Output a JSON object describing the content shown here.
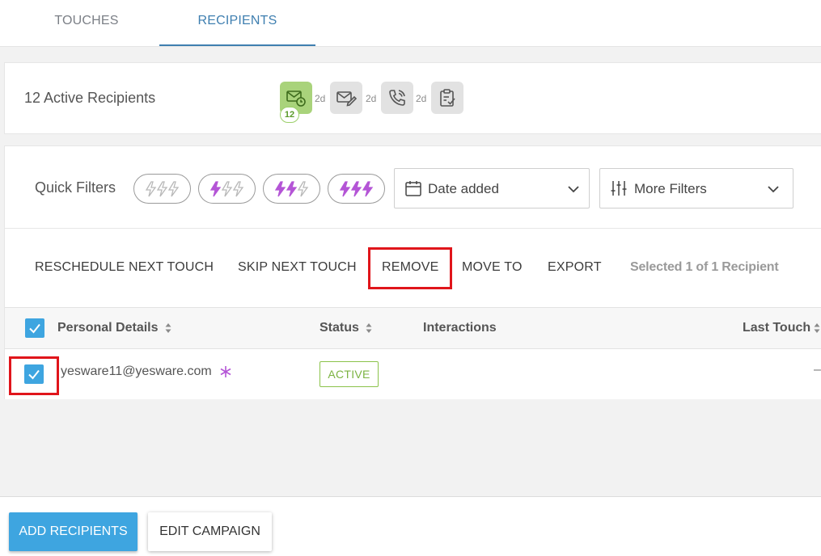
{
  "tabs": [
    {
      "label": "TOUCHES",
      "active": false
    },
    {
      "label": "RECIPIENTS",
      "active": true
    }
  ],
  "summary": {
    "title": "12 Active Recipients",
    "touches": [
      {
        "icon": "email-scheduled-icon",
        "active": true,
        "count": "12"
      },
      {
        "icon": "email-edit-icon",
        "active": false
      },
      {
        "icon": "phone-call-icon",
        "active": false
      },
      {
        "icon": "task-clipboard-icon",
        "active": false
      }
    ],
    "gaps": [
      "2d",
      "2d",
      "2d"
    ]
  },
  "quick_filters": {
    "label": "Quick Filters",
    "pills": [
      {
        "icon": "bolt-level-0-icon",
        "level": 0
      },
      {
        "icon": "bolt-level-1-icon",
        "level": 1
      },
      {
        "icon": "bolt-level-2-icon",
        "level": 2
      },
      {
        "icon": "bolt-level-3-icon",
        "level": 3
      }
    ],
    "date_select": "Date added",
    "more_filters": "More Filters"
  },
  "actions": {
    "reschedule": "RESCHEDULE NEXT TOUCH",
    "skip": "SKIP NEXT TOUCH",
    "remove": "REMOVE",
    "move_to": "MOVE TO",
    "export": "EXPORT",
    "selected": "Selected 1 of 1 Recipient"
  },
  "table": {
    "headers": {
      "personal": "Personal Details",
      "status": "Status",
      "interactions": "Interactions",
      "last_touch": "Last Touch"
    },
    "rows": [
      {
        "email": "yesware11@yesware.com",
        "status": "ACTIVE",
        "interactions": "",
        "last_touch": "–",
        "checked": true
      }
    ]
  },
  "footer": {
    "add_recipients": "ADD RECIPIENTS",
    "edit_campaign": "EDIT CAMPAIGN"
  },
  "colors": {
    "accent_blue": "#3ea5e0",
    "tab_active": "#3f7fb0",
    "highlight_red": "#e0151b",
    "bolt_purple": "#b455d6",
    "status_green": "#7cb342"
  }
}
